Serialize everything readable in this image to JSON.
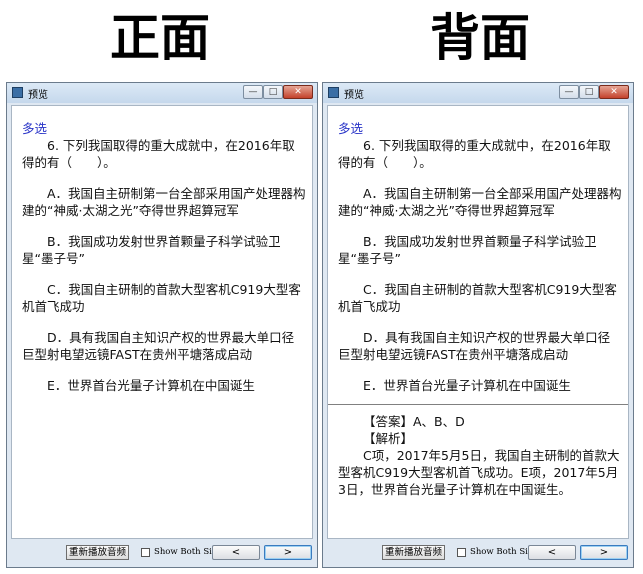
{
  "labels": {
    "front": "正面",
    "back": "背面"
  },
  "window": {
    "title": "预览",
    "minimize_glyph": "—",
    "maximize_glyph": "□",
    "close_glyph": "✕"
  },
  "question": {
    "type": "多选",
    "stem": "6. 下列我国取得的重大成就中，在2016年取得的有（　　）。",
    "options": [
      "A．我国自主研制第一台全部采用国产处理器构建的“神威·太湖之光”夺得世界超算冠军",
      "B．我国成功发射世界首颗量子科学试验卫星“墨子号”",
      "C．我国自主研制的首款大型客机C919大型客机首飞成功",
      "D．具有我国自主知识产权的世界最大单口径巨型射电望远镜FAST在贵州平塘落成启动",
      "E．世界首台光量子计算机在中国诞生"
    ]
  },
  "answer": {
    "answer_line": "【答案】A、B、D",
    "analysis_label": "【解析】",
    "analysis_text": "C项，2017年5月5日，我国自主研制的首款大型客机C919大型客机首飞成功。E项，2017年5月3日，世界首台光量子计算机在中国诞生。"
  },
  "bottom": {
    "replay_button": "重新播放音频",
    "show_both_sides": "Show Both Sides",
    "prev_glyph": "<",
    "next_glyph": ">"
  },
  "colors": {
    "question_type": "#2a35c8",
    "close_button": "#c4422c"
  }
}
